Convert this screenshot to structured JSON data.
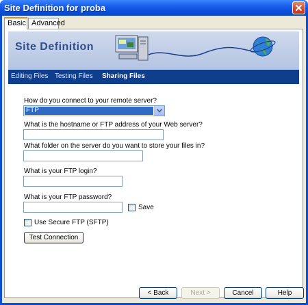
{
  "window": {
    "title": "Site Definition for proba",
    "close_icon": "close-icon"
  },
  "tabs": [
    {
      "label": "Basic",
      "active": true
    },
    {
      "label": "Advanced",
      "active": false
    }
  ],
  "banner": {
    "title": "Site Definition",
    "icons": [
      "computer-icon",
      "globe-icon"
    ]
  },
  "nav": [
    {
      "label": "Editing Files",
      "active": false
    },
    {
      "label": "Testing Files",
      "active": false
    },
    {
      "label": "Sharing Files",
      "active": true
    }
  ],
  "form": {
    "connect_label": "How do you connect to your remote server?",
    "connect_value": "FTP",
    "host_label": "What is the hostname or FTP address of your Web server?",
    "host_value": "",
    "folder_label": "What folder on the server do you want to store your files in?",
    "folder_value": "",
    "login_label": "What is your FTP login?",
    "login_value": "",
    "password_label": "What is your FTP password?",
    "password_value": "",
    "save_label": "Save",
    "save_checked": false,
    "sftp_label": "Use Secure FTP (SFTP)",
    "sftp_checked": false,
    "test_button": "Test Connection"
  },
  "footer": {
    "back": "< Back",
    "next": "Next >",
    "cancel": "Cancel",
    "help": "Help"
  },
  "colors": {
    "title_bar": "#0a4fd8",
    "nav_bar": "#0f3f8c",
    "selection": "#316ac5"
  }
}
